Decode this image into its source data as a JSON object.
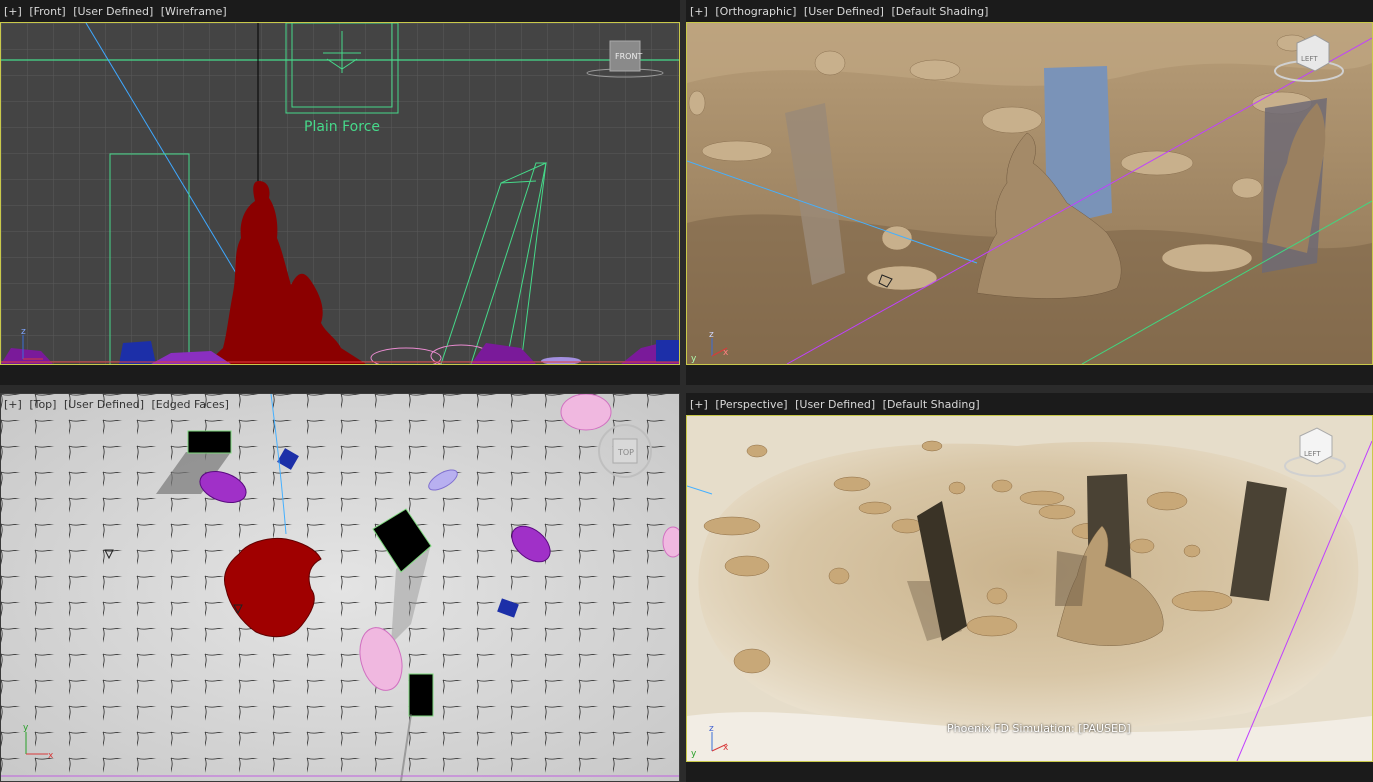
{
  "viewports": {
    "front": {
      "label_parts": [
        "[+]",
        "[Front]",
        "[User Defined]",
        "[Wireframe]"
      ],
      "viewcube": "FRONT",
      "object_label": "Plain Force"
    },
    "ortho": {
      "label_parts": [
        "[+]",
        "[Orthographic]",
        "[User Defined]",
        "[Default Shading]"
      ],
      "viewcube": "LEFT"
    },
    "top": {
      "label_parts": [
        "[+]",
        "[Top]",
        "[User Defined]",
        "[Edged Faces]"
      ],
      "viewcube": "TOP"
    },
    "persp": {
      "label_parts": [
        "[+]",
        "[Perspective]",
        "[User Defined]",
        "[Default Shading]"
      ],
      "viewcube": "LEFT",
      "status": "Phoenix FD Simulation: [PAUSED]"
    }
  },
  "axes": {
    "x": "x",
    "y": "y",
    "z": "z"
  },
  "colors": {
    "background": "#2b2b2b",
    "active_border": "#c9c94a",
    "statue_red": "#8b0000",
    "sand": "#b49870"
  }
}
